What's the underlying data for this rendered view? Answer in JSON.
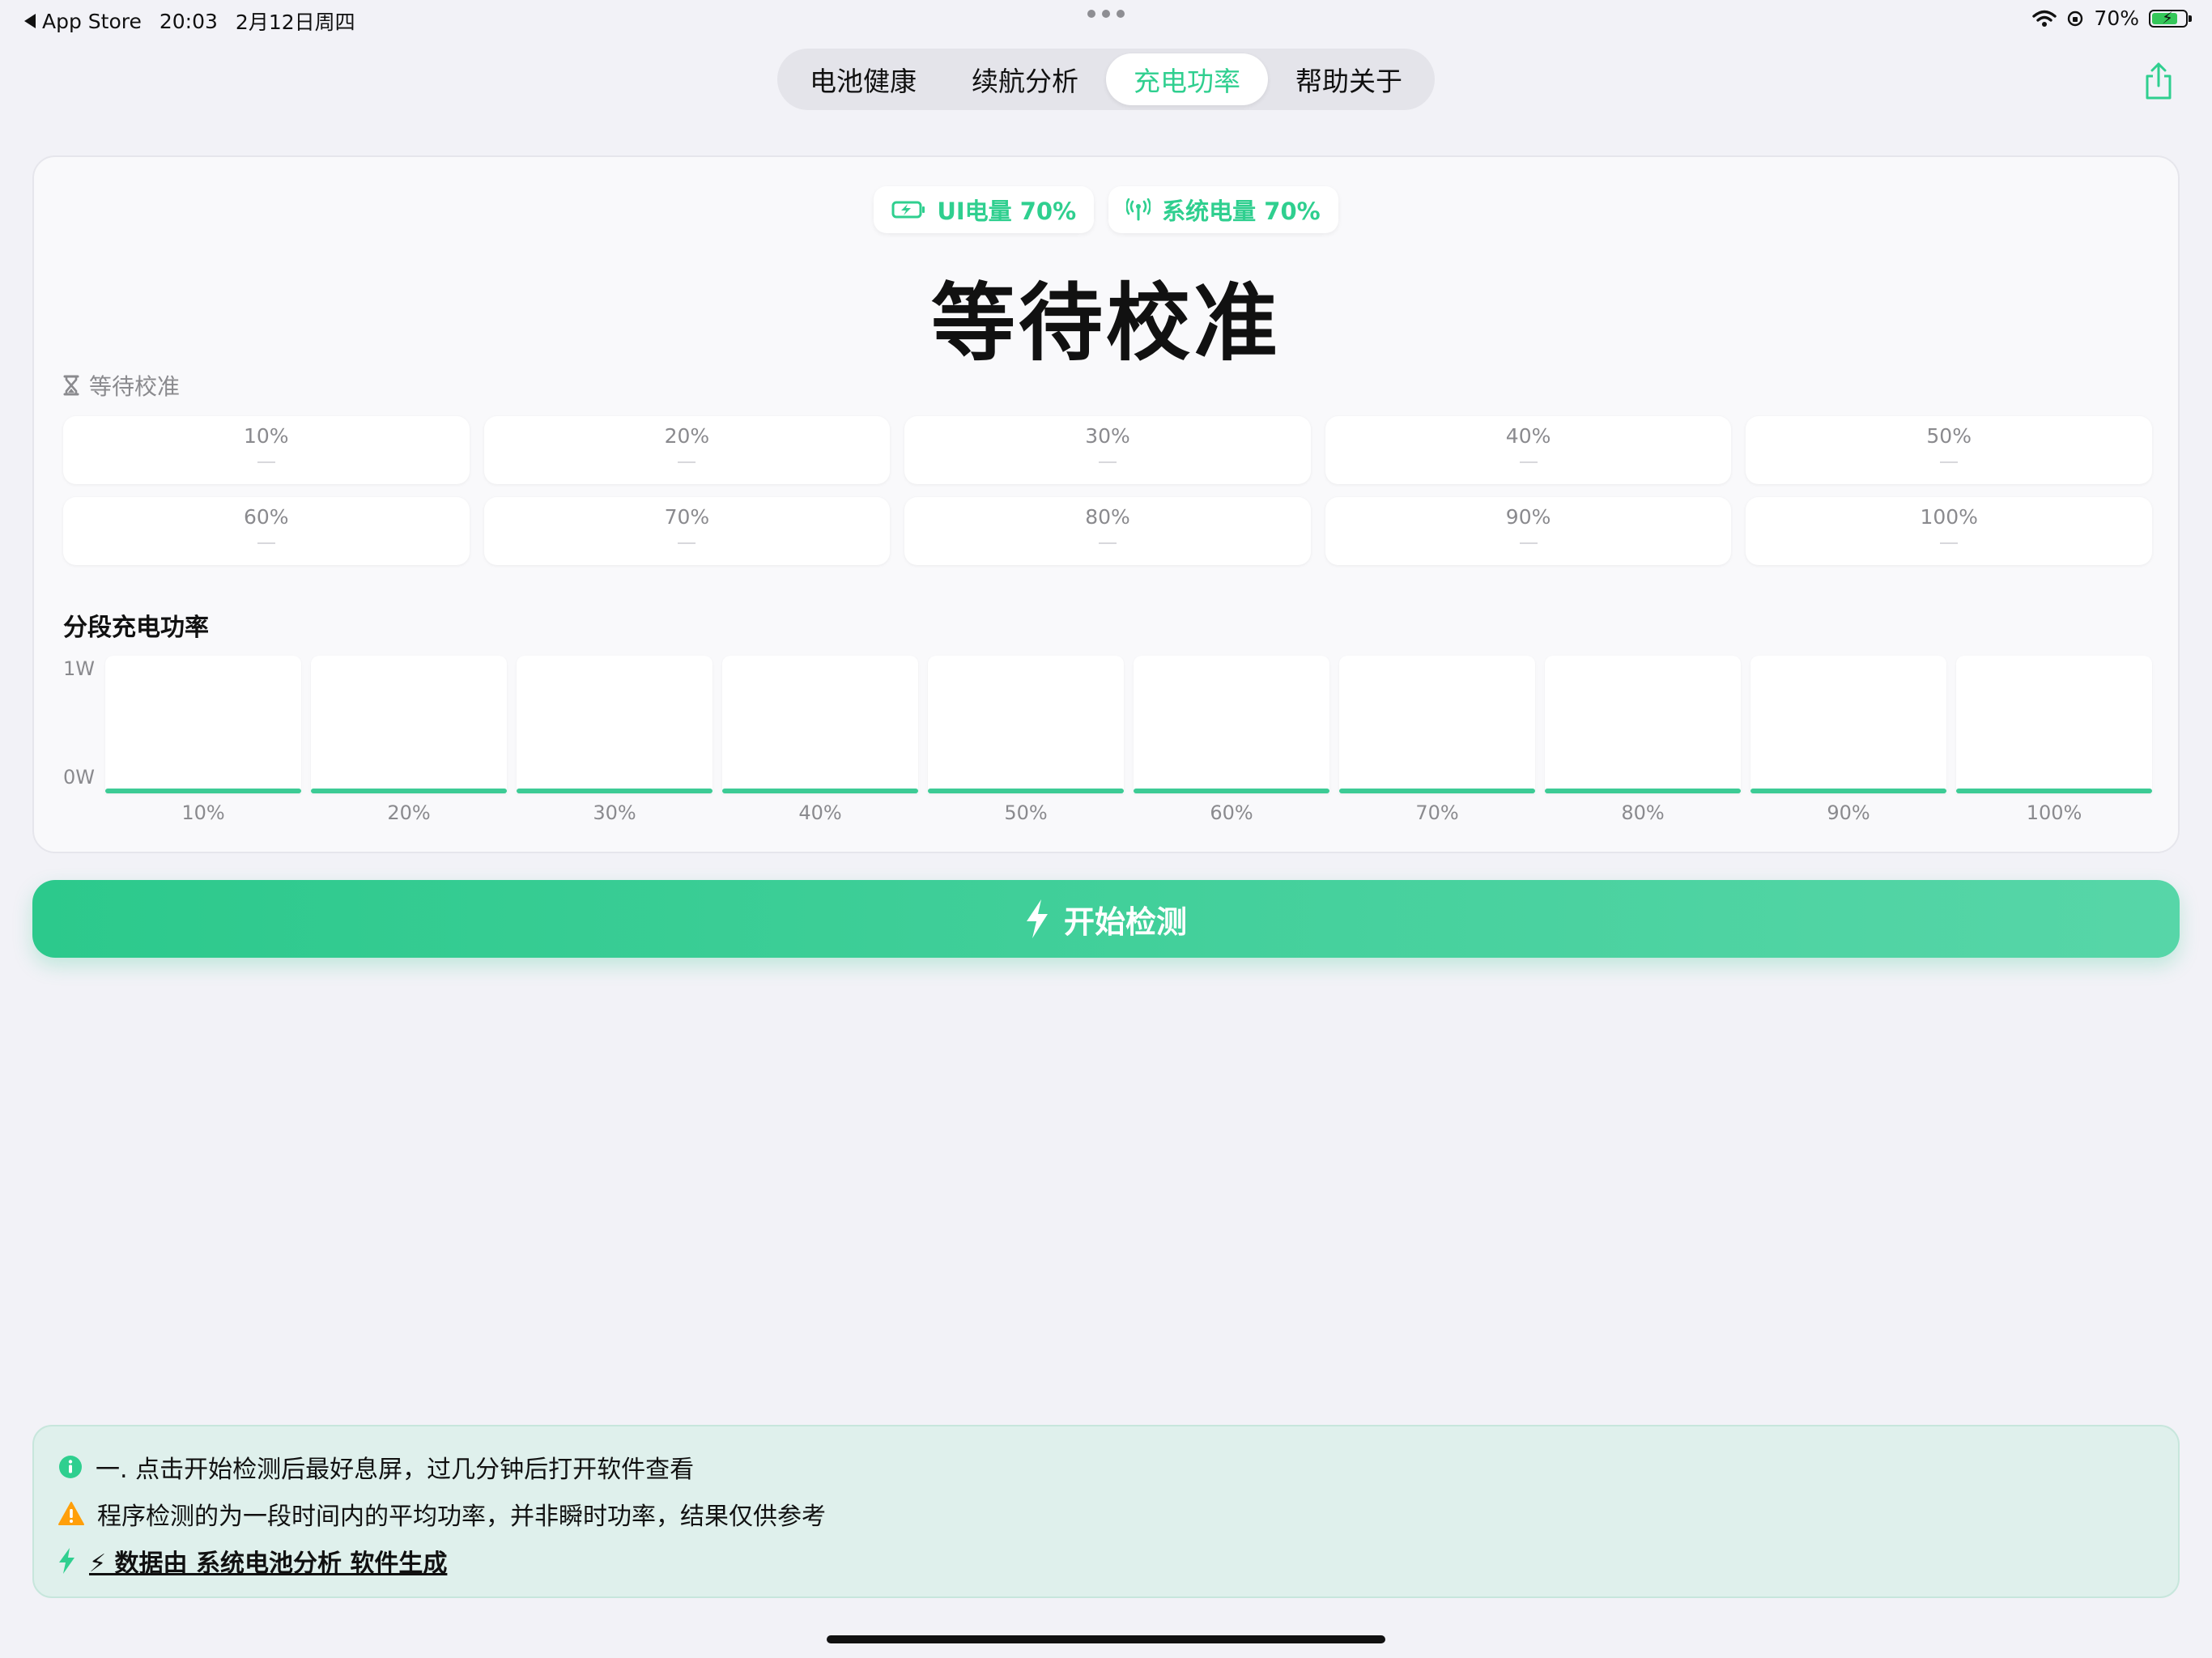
{
  "status_bar": {
    "back_label": "App Store",
    "time": "20:03",
    "date": "2月12日周四",
    "battery_pct": "70%"
  },
  "tabs": [
    {
      "label": "电池健康",
      "active": false
    },
    {
      "label": "续航分析",
      "active": false
    },
    {
      "label": "充电功率",
      "active": true
    },
    {
      "label": "帮助关于",
      "active": false
    }
  ],
  "header": {
    "ui_level": "UI电量 70%",
    "system_level": "系统电量 70%",
    "title": "等待校准",
    "status_text": "等待校准"
  },
  "calibration_cells": [
    {
      "pct": "10%",
      "value": "—"
    },
    {
      "pct": "20%",
      "value": "—"
    },
    {
      "pct": "30%",
      "value": "—"
    },
    {
      "pct": "40%",
      "value": "—"
    },
    {
      "pct": "50%",
      "value": "—"
    },
    {
      "pct": "60%",
      "value": "—"
    },
    {
      "pct": "70%",
      "value": "—"
    },
    {
      "pct": "80%",
      "value": "—"
    },
    {
      "pct": "90%",
      "value": "—"
    },
    {
      "pct": "100%",
      "value": "—"
    }
  ],
  "chart_section_title": "分段充电功率",
  "chart_data": {
    "type": "bar",
    "categories": [
      "10%",
      "20%",
      "30%",
      "40%",
      "50%",
      "60%",
      "70%",
      "80%",
      "90%",
      "100%"
    ],
    "values": [
      0,
      0,
      0,
      0,
      0,
      0,
      0,
      0,
      0,
      0
    ],
    "ylim": [
      0,
      1
    ],
    "ytick_labels": [
      "1W",
      "0W"
    ],
    "title": "分段充电功率"
  },
  "start_button": {
    "label": "开始检测"
  },
  "info": {
    "line1": "一. 点击开始检测后最好息屏，过几分钟后打开软件查看",
    "line2": "程序检测的为一段时间内的平均功率，并非瞬时功率，结果仅供参考",
    "line3": "⚡ 数据由 系统电池分析 软件生成"
  },
  "colors": {
    "accent": "#2fcf8f",
    "background": "#f2f2f7",
    "info_bg": "#dff0ec",
    "warning": "#ff9f0a"
  }
}
